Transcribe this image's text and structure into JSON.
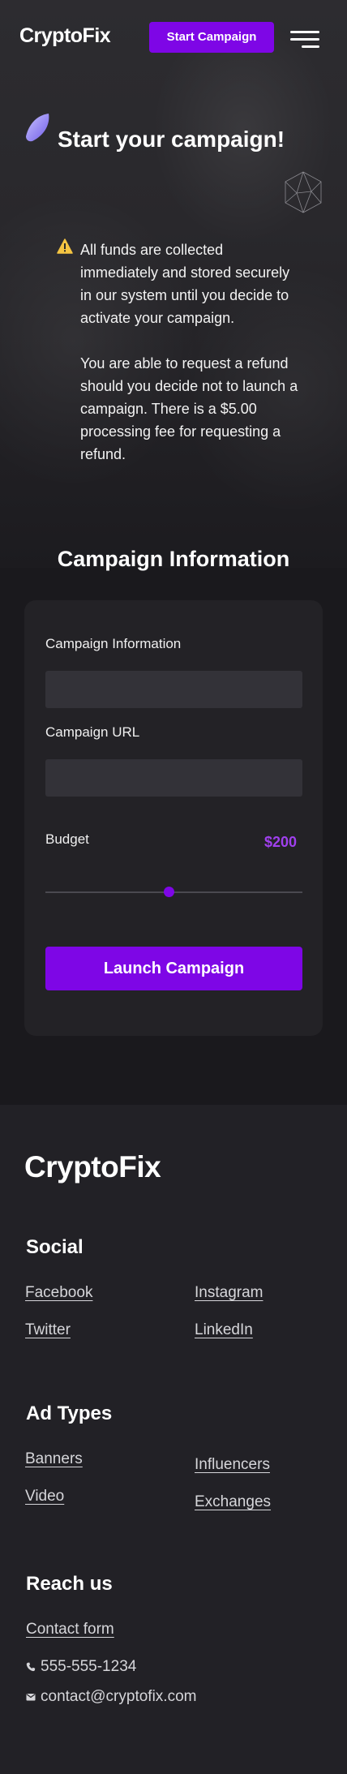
{
  "header": {
    "logo": "CryptoFix",
    "start_button": "Start Campaign",
    "menu_icon": "hamburger-menu-icon"
  },
  "hero": {
    "title": "Start your campaign!",
    "notice_paragraph_1": "All funds are collected immediately and stored securely in our system until you decide to activate your campaign.",
    "notice_paragraph_2": "You are able to request a refund should you decide not to launch a campaign. There is a $5.00 processing fee for requesting a refund.",
    "warning_icon": "warning-icon"
  },
  "form": {
    "section_title": "Campaign Information",
    "campaign_info_label": "Campaign Information",
    "campaign_info_value": "",
    "campaign_url_label": "Campaign URL",
    "campaign_url_value": "",
    "budget_label": "Budget",
    "budget_value": "$200",
    "budget_slider_fraction": 0.48,
    "launch_button": "Launch Campaign"
  },
  "footer": {
    "logo": "CryptoFix",
    "social_heading": "Social",
    "social_links": [
      "Facebook",
      "Instagram",
      "Twitter",
      "LinkedIn"
    ],
    "ad_types_heading": "Ad Types",
    "ad_types_links": [
      "Banners",
      "Influencers",
      "Video",
      "Exchanges"
    ],
    "reach_heading": "Reach us",
    "contact_form_link": "Contact form",
    "phone": "555-555-1234",
    "email": "contact@cryptofix.com"
  },
  "colors": {
    "accent": "#7e06e6",
    "budget_value": "#a040ee",
    "background": "#1a191d",
    "footer_background": "#222126",
    "warning": "#f5c542"
  }
}
